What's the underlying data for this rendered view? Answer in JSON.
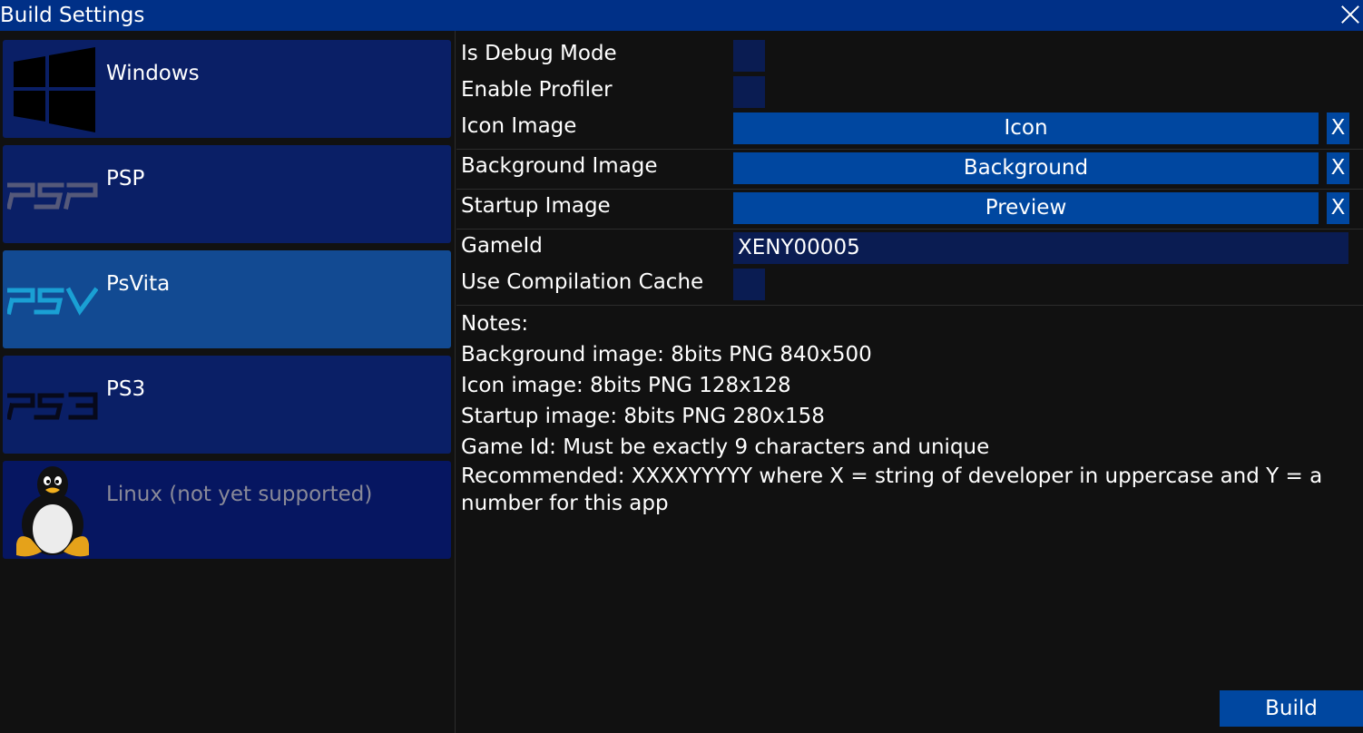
{
  "window": {
    "title": "Build Settings"
  },
  "platforms": [
    {
      "label": "Windows",
      "icon": "windows-logo-icon"
    },
    {
      "label": "PSP",
      "icon": "psp-logo-icon"
    },
    {
      "label": "PsVita",
      "icon": "psvita-logo-icon",
      "selected": true
    },
    {
      "label": "PS3",
      "icon": "ps3-logo-icon"
    },
    {
      "label": "Linux (not yet supported)",
      "icon": "linux-tux-icon",
      "disabled": true
    }
  ],
  "settings": {
    "debug_mode": {
      "label": "Is Debug Mode",
      "checked": false
    },
    "profiler": {
      "label": "Enable Profiler",
      "checked": false
    },
    "icon_image": {
      "label": "Icon Image",
      "button": "Icon",
      "clear": "X"
    },
    "background_image": {
      "label": "Background Image",
      "button": "Background",
      "clear": "X"
    },
    "startup_image": {
      "label": "Startup Image",
      "button": "Preview",
      "clear": "X"
    },
    "game_id": {
      "label": "GameId",
      "value": "XENY00005"
    },
    "compilation_cache": {
      "label": "Use Compilation Cache",
      "checked": false
    }
  },
  "notes": {
    "title": "Notes:",
    "lines": [
      "Background image: 8bits PNG 840x500",
      "Icon image: 8bits PNG 128x128",
      "Startup image: 8bits PNG 280x158",
      "Game Id: Must be exactly 9 characters and unique",
      "Recommended: XXXXYYYYY where X = string of developer in uppercase and Y = a number for this app"
    ]
  },
  "actions": {
    "build": "Build"
  },
  "colors": {
    "titlebar": "#003087",
    "platform_bg": "#0a1f66",
    "platform_selected": "#124a92",
    "button_blue": "#0047a0",
    "field_bg": "#0a1c52",
    "window_bg": "#111111"
  }
}
